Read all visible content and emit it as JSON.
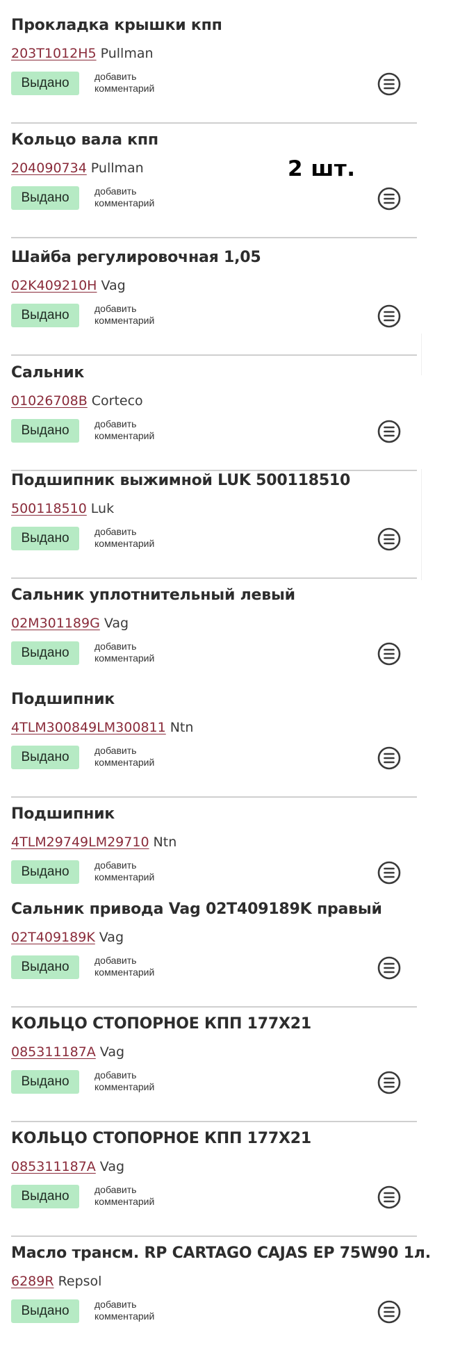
{
  "items": [
    {
      "title": "Прокладка крышки кпп",
      "code": "203T1012H5",
      "brand": "Pullman",
      "status": "Выдано",
      "comment_line1": "добавить",
      "comment_line2": "комментарий"
    },
    {
      "title": "Кольцо вала кпп",
      "code": "204090734",
      "brand": "Pullman",
      "status": "Выдано",
      "comment_line1": "добавить",
      "comment_line2": "комментарий"
    },
    {
      "title": "Шайба регулировочная 1,05",
      "code": "02K409210H",
      "brand": "Vag",
      "status": "Выдано",
      "comment_line1": "добавить",
      "comment_line2": "комментарий"
    },
    {
      "title": "Сальник",
      "code": "01026708B",
      "brand": "Corteco",
      "status": "Выдано",
      "comment_line1": "добавить",
      "comment_line2": "комментарий"
    },
    {
      "title": "Подшипник выжимной LUK 500118510",
      "code": "500118510",
      "brand": "Luk",
      "status": "Выдано",
      "comment_line1": "добавить",
      "comment_line2": "комментарий"
    },
    {
      "title": "Сальник уплотнительный левый",
      "code": "02M301189G",
      "brand": "Vag",
      "status": "Выдано",
      "comment_line1": "добавить",
      "comment_line2": "комментарий"
    },
    {
      "title": "Подшипник",
      "code": "4TLM300849LM300811",
      "brand": "Ntn",
      "status": "Выдано",
      "comment_line1": "добавить",
      "comment_line2": "комментарий"
    },
    {
      "title": "Подшипник",
      "code": "4TLM29749LM29710",
      "brand": "Ntn",
      "status": "Выдано",
      "comment_line1": "добавить",
      "comment_line2": "комментарий"
    },
    {
      "title": "Сальник привода Vag 02T409189K правый",
      "code": "02T409189K",
      "brand": "Vag",
      "status": "Выдано",
      "comment_line1": "добавить",
      "comment_line2": "комментарий"
    },
    {
      "title": "КОЛЬЦО СТОПОРНОЕ КПП 177X21",
      "code": "085311187A",
      "brand": "Vag",
      "status": "Выдано",
      "comment_line1": "добавить",
      "comment_line2": "комментарий"
    },
    {
      "title": "КОЛЬЦО СТОПОРНОЕ КПП 177X21",
      "code": "085311187A",
      "brand": "Vag",
      "status": "Выдано",
      "comment_line1": "добавить",
      "comment_line2": "комментарий"
    },
    {
      "title": "Масло трансм. RP CARTAGO CAJAS EP 75W90 1л.",
      "code": "6289R",
      "brand": "Repsol",
      "status": "Выдано",
      "comment_line1": "добавить",
      "comment_line2": "комментарий"
    }
  ],
  "overlay": {
    "quantity": "2 шт."
  },
  "icons": {
    "item_menu": "menu-lines-circle-icon"
  },
  "colors": {
    "status_badge_bg": "#b6eac4",
    "part_code": "#8a2b3a",
    "divider": "#cfcfcf"
  }
}
